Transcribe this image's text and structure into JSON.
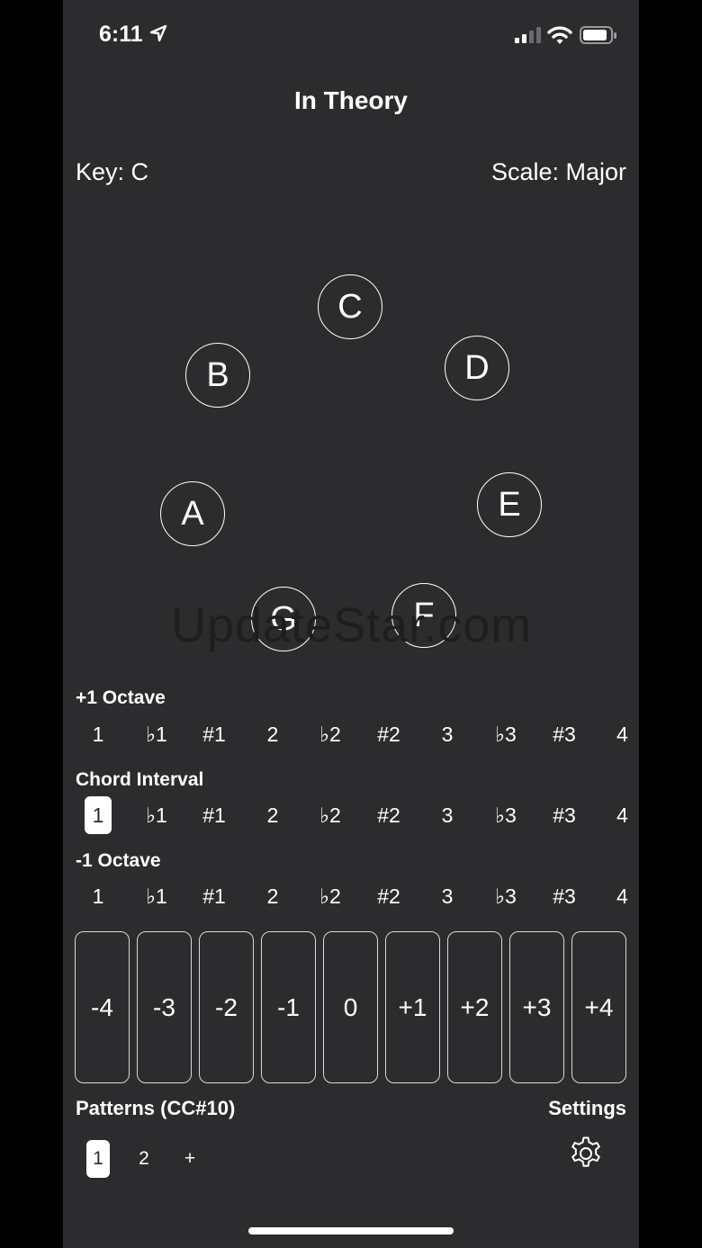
{
  "status_bar": {
    "time": "6:11",
    "icons": [
      "location-arrow-icon",
      "cellular-signal-icon",
      "wifi-icon",
      "battery-icon"
    ]
  },
  "header": {
    "title": "In Theory"
  },
  "key": {
    "label": "Key: C"
  },
  "scale": {
    "label": "Scale: Major"
  },
  "notes": [
    "C",
    "D",
    "E",
    "F",
    "G",
    "A",
    "B"
  ],
  "watermark": "UpdateStar.com",
  "plus_octave": {
    "title": "+1 Octave",
    "intervals": [
      "1",
      "♭1",
      "#1",
      "2",
      "♭2",
      "#2",
      "3",
      "♭3",
      "#3",
      "4"
    ]
  },
  "chord_interval": {
    "title": "Chord Interval",
    "selected": "1",
    "intervals": [
      "1",
      "♭1",
      "#1",
      "2",
      "♭2",
      "#2",
      "3",
      "♭3",
      "#3",
      "4"
    ]
  },
  "minus_octave": {
    "title": "-1 Octave",
    "intervals": [
      "1",
      "♭1",
      "#1",
      "2",
      "♭2",
      "#2",
      "3",
      "♭3",
      "#3",
      "4"
    ]
  },
  "offsets": [
    "-4",
    "-3",
    "-2",
    "-1",
    "0",
    "+1",
    "+2",
    "+3",
    "+4"
  ],
  "patterns": {
    "label": "Patterns (CC#10)",
    "items": [
      "1",
      "2",
      "+"
    ],
    "selected": "1"
  },
  "settings": {
    "label": "Settings",
    "icon": "gear-icon"
  },
  "colors": {
    "background": "#2c2c2e",
    "foreground": "#ffffff",
    "letterbox": "#000000"
  }
}
